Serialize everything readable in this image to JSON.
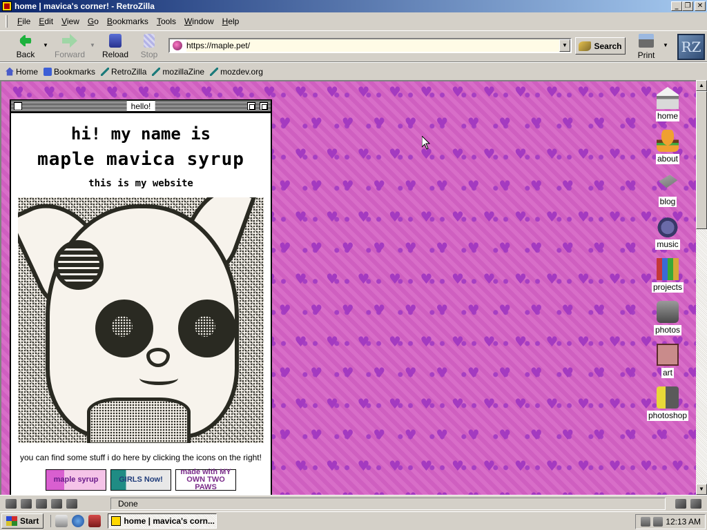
{
  "window": {
    "title": "home | mavica's corner! - RetroZilla"
  },
  "menu": [
    "File",
    "Edit",
    "View",
    "Go",
    "Bookmarks",
    "Tools",
    "Window",
    "Help"
  ],
  "toolbar": {
    "back": "Back",
    "forward": "Forward",
    "reload": "Reload",
    "stop": "Stop",
    "url": "https://maple.pet/",
    "search": "Search",
    "print": "Print",
    "logo": "RZ"
  },
  "bookmarks": [
    "Home",
    "Bookmarks",
    "RetroZilla",
    "mozillaZine",
    "mozdev.org"
  ],
  "page": {
    "window_title": "hello!",
    "greeting": "hi! my name is",
    "name": "maple mavica syrup",
    "tagline": "this is my website",
    "find": "you can find some stuff i do here by clicking the icons on the right!",
    "badges": [
      {
        "label": "maple syrup"
      },
      {
        "label": "GIRLS Now!"
      },
      {
        "label": "made with MY OWN TWO PAWS"
      }
    ],
    "icons": [
      "home",
      "about",
      "blog",
      "music",
      "projects",
      "photos",
      "art",
      "photoshop"
    ]
  },
  "status": {
    "text": "Done"
  },
  "taskbar": {
    "start": "Start",
    "task": "home | mavica's corn...",
    "clock": "12:13 AM"
  },
  "colors": {
    "title_active": "#0a246a",
    "page_bg": "#d667c8",
    "heart": "#a43ac0"
  }
}
